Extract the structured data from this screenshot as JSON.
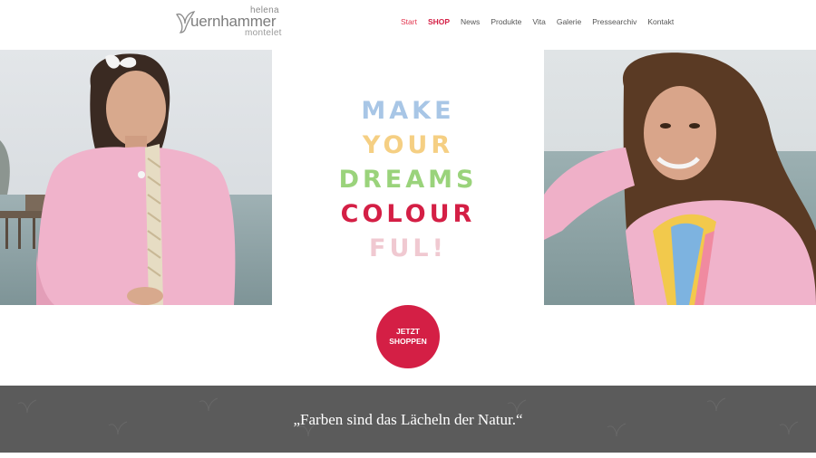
{
  "logo": {
    "top": "helena",
    "main": "uernhammer",
    "bottom": "montelet"
  },
  "nav": {
    "items": [
      {
        "label": "Start"
      },
      {
        "label": "SHOP"
      },
      {
        "label": "News"
      },
      {
        "label": "Produkte"
      },
      {
        "label": "Vita"
      },
      {
        "label": "Galerie"
      },
      {
        "label": "Pressearchiv"
      },
      {
        "label": "Kontakt"
      }
    ]
  },
  "hero": {
    "slogan": [
      {
        "text": "MAKE",
        "color": "#a8c6e6"
      },
      {
        "text": "YOUR",
        "color": "#f5cf83"
      },
      {
        "text": "DREAMS",
        "color": "#9ad37b"
      },
      {
        "text": "COLOUR",
        "color": "#d41f45"
      },
      {
        "text": "FUL!",
        "color": "#f0c9d1"
      }
    ],
    "left_photo": "woman-in-pink-cardigan-photo",
    "right_photo": "woman-with-scarf-photo"
  },
  "cta": {
    "line1": "JETZT",
    "line2": "SHOPPEN"
  },
  "quote": {
    "text": "„Farben sind das Lächeln der Natur.“"
  },
  "colors": {
    "accent": "#d41f45",
    "band": "#5b5b5b"
  }
}
